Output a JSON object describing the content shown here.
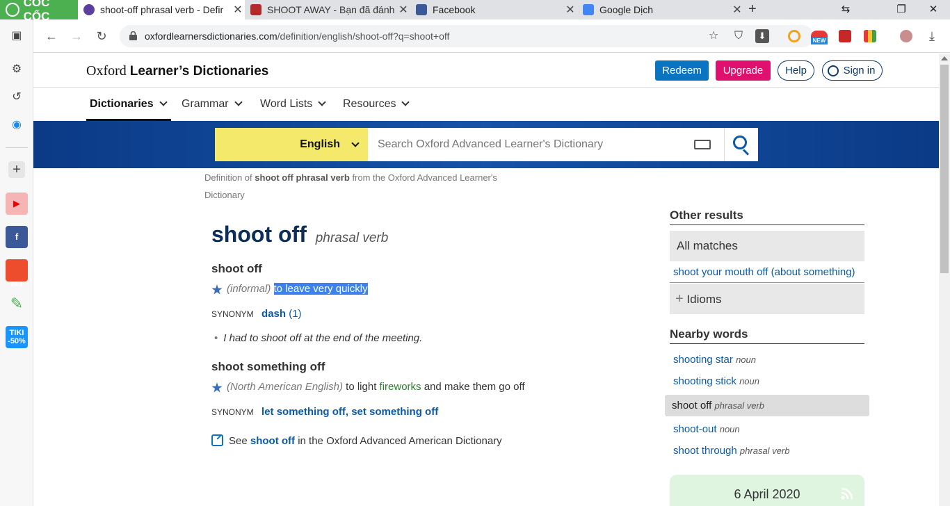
{
  "browser": {
    "brand": "CỐC CỐC",
    "tabs": [
      {
        "title": "shoot-off phrasal verb - Defir",
        "active": true
      },
      {
        "title": "SHOOT AWAY - Bạn đã đánh và",
        "active": false
      },
      {
        "title": "Facebook",
        "active": false
      },
      {
        "title": "Google Dịch",
        "active": false
      }
    ],
    "url_host": "oxfordlearnersdictionaries.com",
    "url_path": "/definition/english/shoot-off?q=shoot+off",
    "new_badge": "NEW"
  },
  "sidebar": {
    "tiki_label": "TIKI",
    "tiki_discount": "-50%",
    "shopee_badge": "24.4"
  },
  "header": {
    "brand_light": "Oxford",
    "brand_bold": "Learner’s Dictionaries",
    "redeem": "Redeem",
    "upgrade": "Upgrade",
    "help": "Help",
    "signin": "Sign in"
  },
  "menu": [
    "Dictionaries",
    "Grammar",
    "Word Lists",
    "Resources"
  ],
  "search": {
    "language": "English",
    "placeholder": "Search Oxford Advanced Learner's Dictionary"
  },
  "entry": {
    "source_prefix": "Definition of",
    "source_term": "shoot off phrasal verb",
    "source_suffix": "from the Oxford Advanced Learner's Dictionary",
    "headword": "shoot off",
    "pos": "phrasal verb",
    "senses": [
      {
        "head": "shoot off",
        "label": "(informal)",
        "definition": "to leave very quickly",
        "synonym_label": "SYNONYM",
        "synonym": "dash",
        "synonym_num": "(1)",
        "example": "I had to shoot off at the end of the meeting."
      },
      {
        "head": "shoot something off",
        "label": "(North American English)",
        "def_before": "to light",
        "def_link": "fireworks",
        "def_after": "and make them go off",
        "synonym_label": "SYNONYM",
        "synonym": "let something off, set something off"
      }
    ],
    "see_prefix": "See",
    "see_term": "shoot off",
    "see_suffix": "in the Oxford Advanced American Dictionary"
  },
  "right": {
    "other_results_title": "Other results",
    "all_matches": "All matches",
    "match_link": "shoot your mouth off (about something)",
    "idioms": "Idioms",
    "nearby_title": "Nearby words",
    "nearby": [
      {
        "word": "shooting star",
        "pos": "noun"
      },
      {
        "word": "shooting stick",
        "pos": "noun"
      },
      {
        "word": "shoot off",
        "pos": "phrasal verb"
      },
      {
        "word": "shoot-out",
        "pos": "noun"
      },
      {
        "word": "shoot through",
        "pos": "phrasal verb"
      }
    ],
    "wotd_date": "6 April 2020"
  }
}
